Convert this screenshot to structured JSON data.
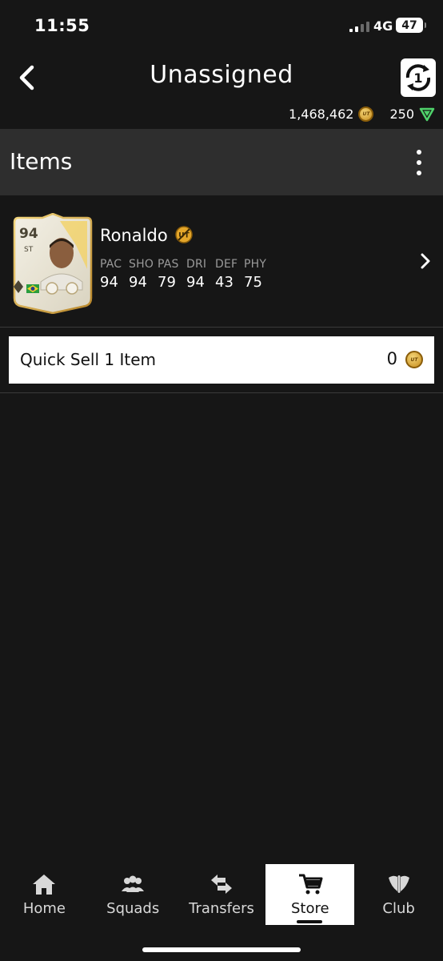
{
  "status_bar": {
    "time": "11:55",
    "network": "4G",
    "battery": "47"
  },
  "header": {
    "title": "Unassigned",
    "coins": "1,468,462",
    "points": "250",
    "coin_glyph": "UT"
  },
  "items_bar": {
    "title": "Items"
  },
  "player": {
    "name": "Ronaldo",
    "rating": "94",
    "position": "ST",
    "stats": [
      {
        "label": "PAC",
        "value": "94"
      },
      {
        "label": "SHO",
        "value": "94"
      },
      {
        "label": "PAS",
        "value": "79"
      },
      {
        "label": "DRI",
        "value": "94"
      },
      {
        "label": "DEF",
        "value": "43"
      },
      {
        "label": "PHY",
        "value": "75"
      }
    ]
  },
  "quick_sell": {
    "label": "Quick Sell 1 Item",
    "value": "0"
  },
  "nav": {
    "items": [
      {
        "label": "Home",
        "icon": "home-icon"
      },
      {
        "label": "Squads",
        "icon": "squads-icon"
      },
      {
        "label": "Transfers",
        "icon": "transfers-icon"
      },
      {
        "label": "Store",
        "icon": "store-cart-icon"
      },
      {
        "label": "Club",
        "icon": "club-icon"
      }
    ],
    "active": "Store"
  },
  "colors": {
    "background": "#161616",
    "bar": "#2e2e2e",
    "accent_gold": "#d7a52b",
    "points_green": "#4fd36b"
  }
}
